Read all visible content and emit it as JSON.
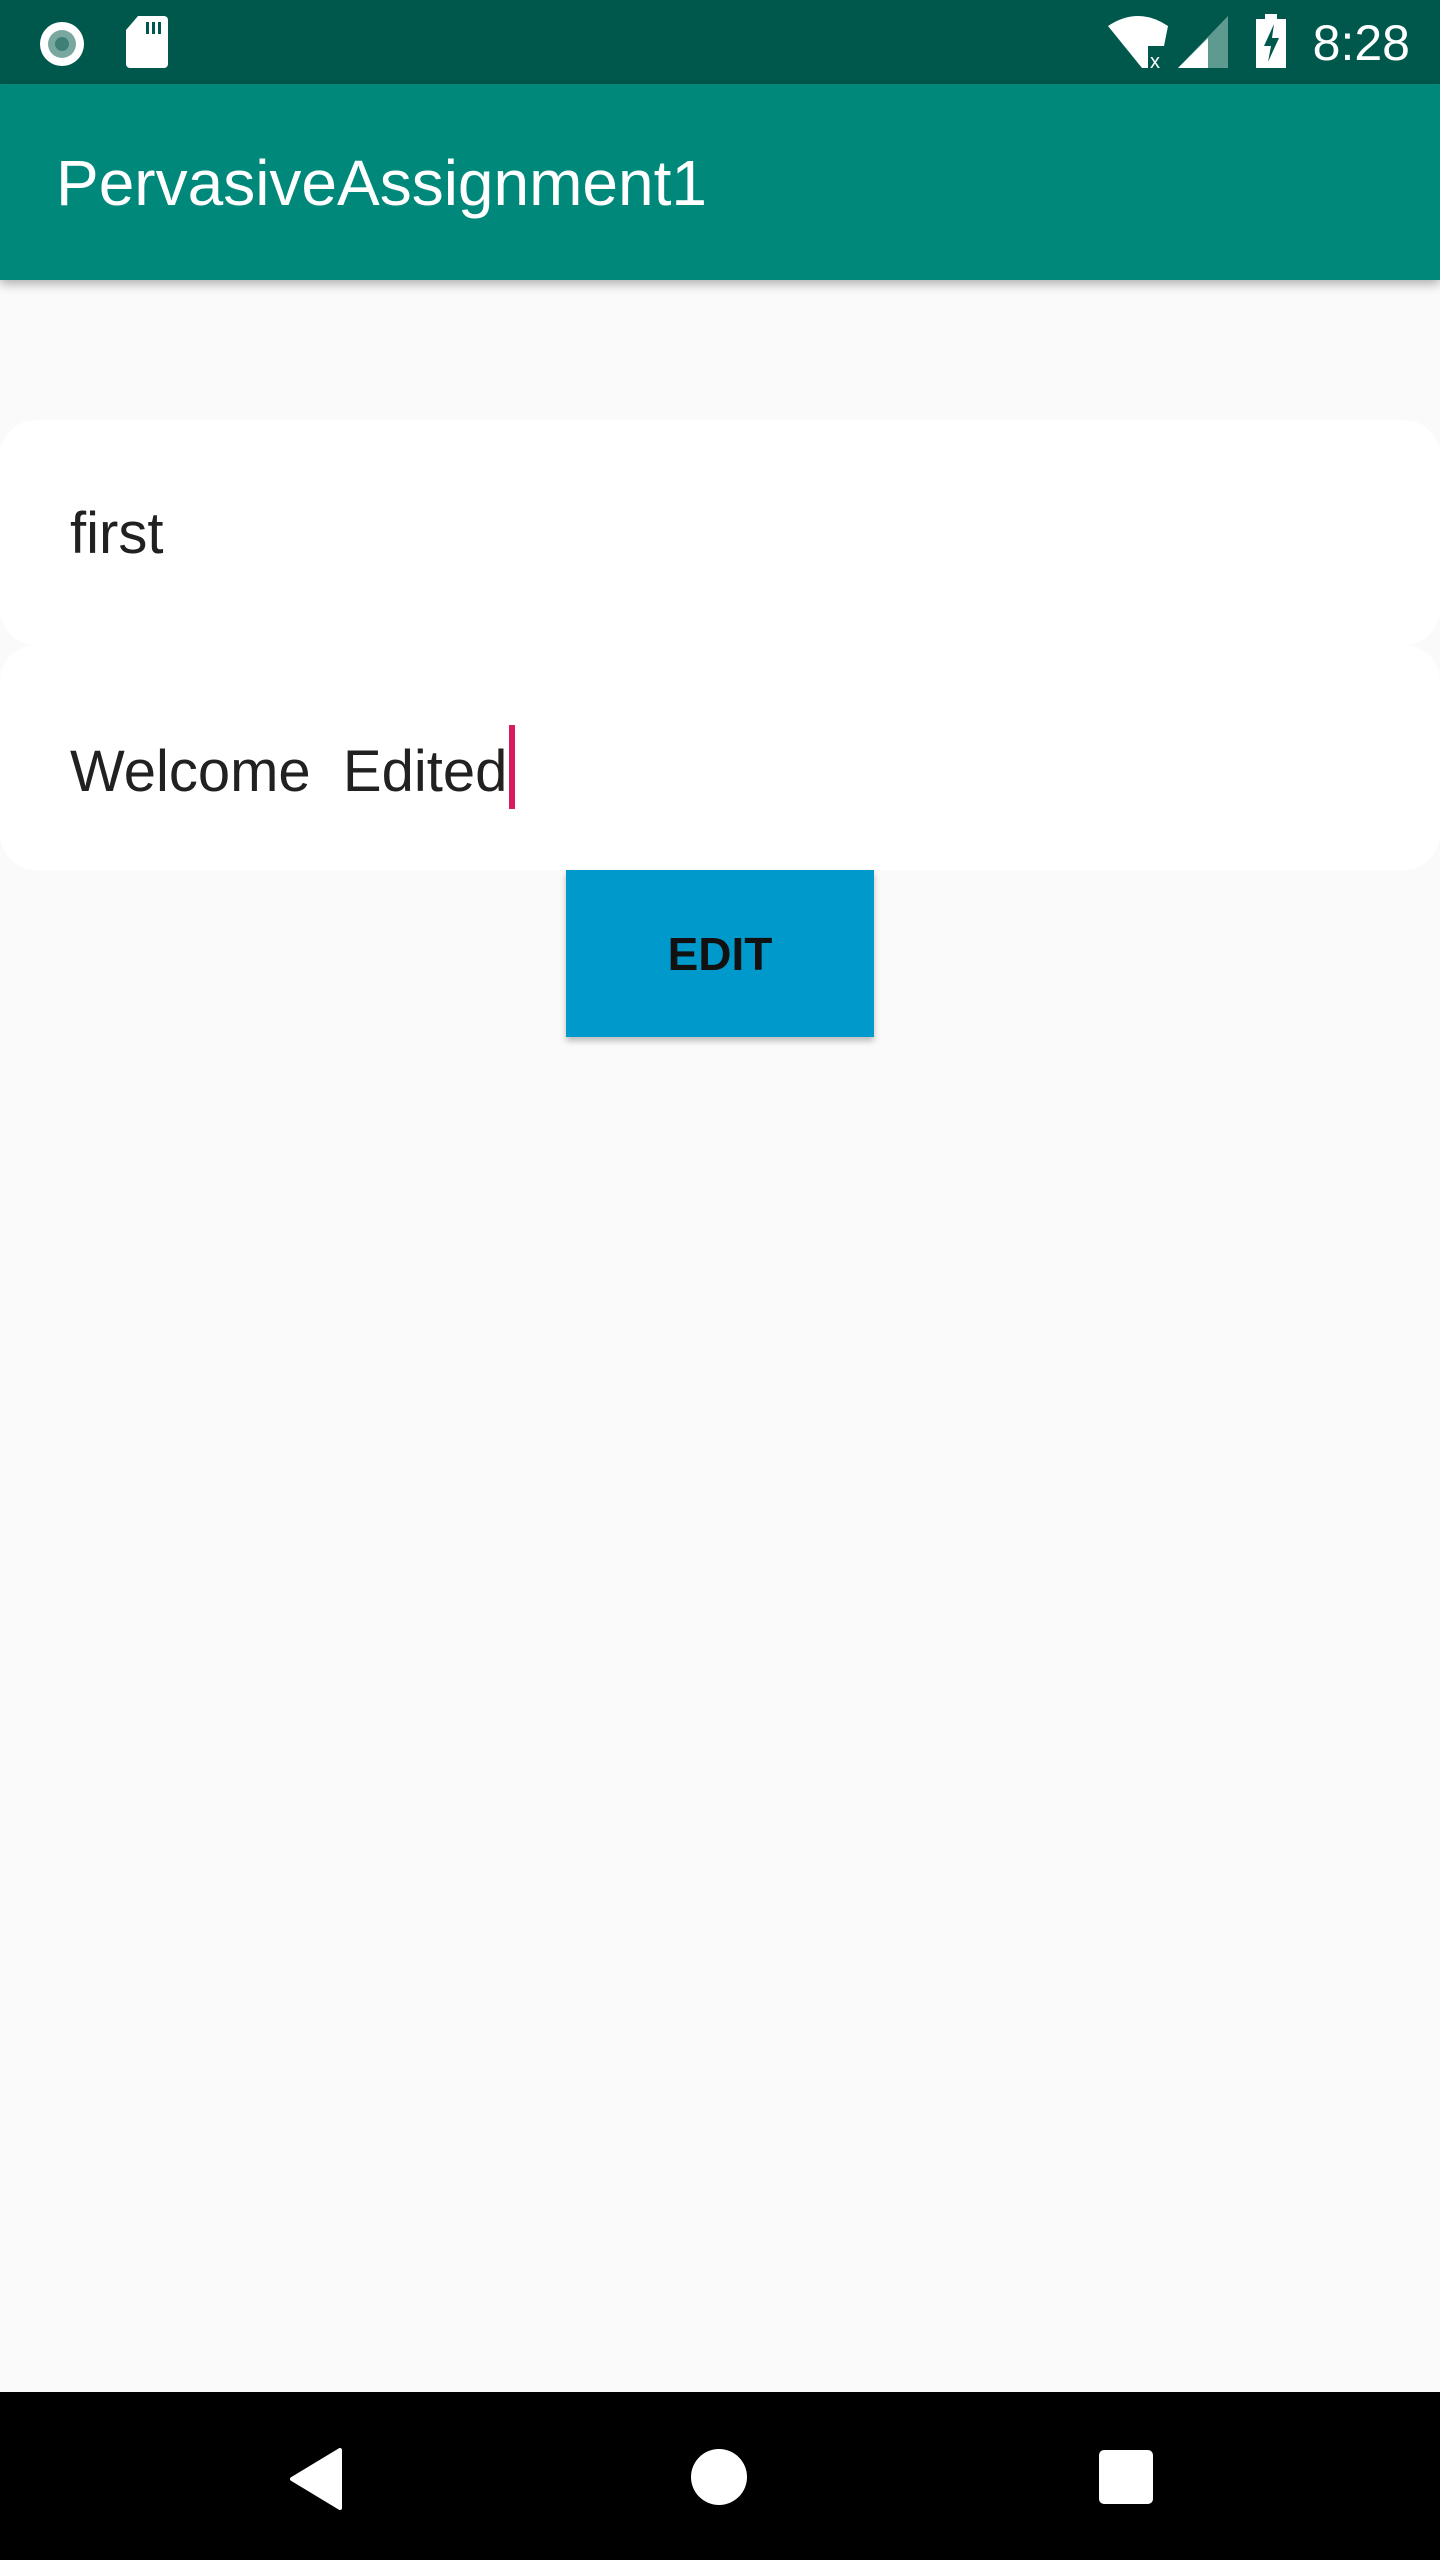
{
  "status_bar": {
    "time": "8:28",
    "icons": [
      "circle-notification-icon",
      "sd-card-icon",
      "wifi-off-icon",
      "signal-icon",
      "battery-charging-icon"
    ]
  },
  "app_bar": {
    "title": "PervasiveAssignment1"
  },
  "form": {
    "field1_value": "first",
    "field2_value": "Welcome  Edited",
    "edit_button_label": "EDIT"
  },
  "colors": {
    "status_bar": "#00584d",
    "app_bar": "#00897b",
    "button": "#0099cc",
    "cursor": "#d81b60"
  },
  "nav_bar": {
    "icons": [
      "back-icon",
      "home-icon",
      "recents-icon"
    ]
  }
}
